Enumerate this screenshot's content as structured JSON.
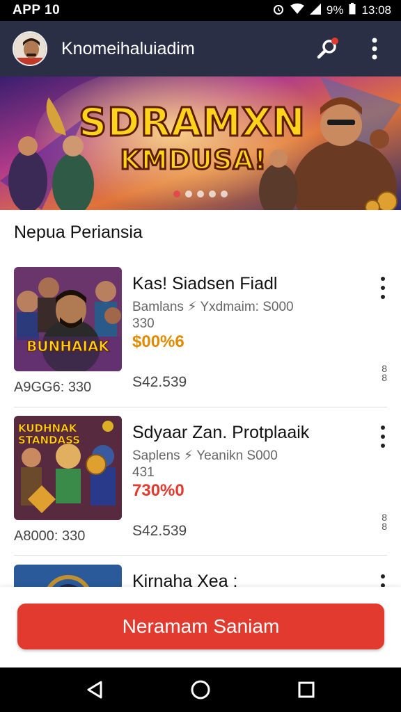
{
  "status_bar": {
    "app_label": "APP 10",
    "battery": "9%",
    "time": "13:08"
  },
  "app_bar": {
    "title": "Knomeihaluiadim"
  },
  "banner": {
    "title_line1": "SDRAMXN",
    "title_line2": "KMDUSA!",
    "dot_count": 5,
    "active_dot": 0
  },
  "section": {
    "title": "Nepua Periansia"
  },
  "items": [
    {
      "title": "Kas! Siadsen Fiadl",
      "subtitle_line1": "Bamlans ⚡ Yxdmaim: S000",
      "subtitle_line2": "330",
      "price": "$00%6",
      "price_color": "#e08a00",
      "thumb_text": "BUNHAIAK",
      "left_meta": "A9GG6: 330",
      "right_meta": "S42.539",
      "side_code": "8\n8"
    },
    {
      "title": "Sdyaar Zan. Protplaaik",
      "subtitle_line1": "Saplens ⚡ Yeanikn S000",
      "subtitle_line2": "431",
      "price": "730%0",
      "price_color": "#e23a2f",
      "thumb_text": "KUDHNAK STANDASS",
      "left_meta": "A8000: 330",
      "right_meta": "S42.539",
      "side_code": "8\n8"
    },
    {
      "title": "Kirnaha Xea :",
      "subtitle_line1": "",
      "subtitle_line2": "",
      "price": "",
      "price_color": "#e23a2f",
      "thumb_text": "",
      "left_meta": "",
      "right_meta": "",
      "side_code": ""
    }
  ],
  "cta": {
    "label": "Neramam Saniam",
    "color": "#e23a2f"
  },
  "colors": {
    "app_bar": "#2a2f45",
    "accent": "#e23a2f"
  },
  "icons": {
    "app_bar_actions": [
      "search-notification-icon",
      "more-vert-icon"
    ],
    "nav": [
      "back-icon",
      "home-icon",
      "recents-icon"
    ]
  }
}
